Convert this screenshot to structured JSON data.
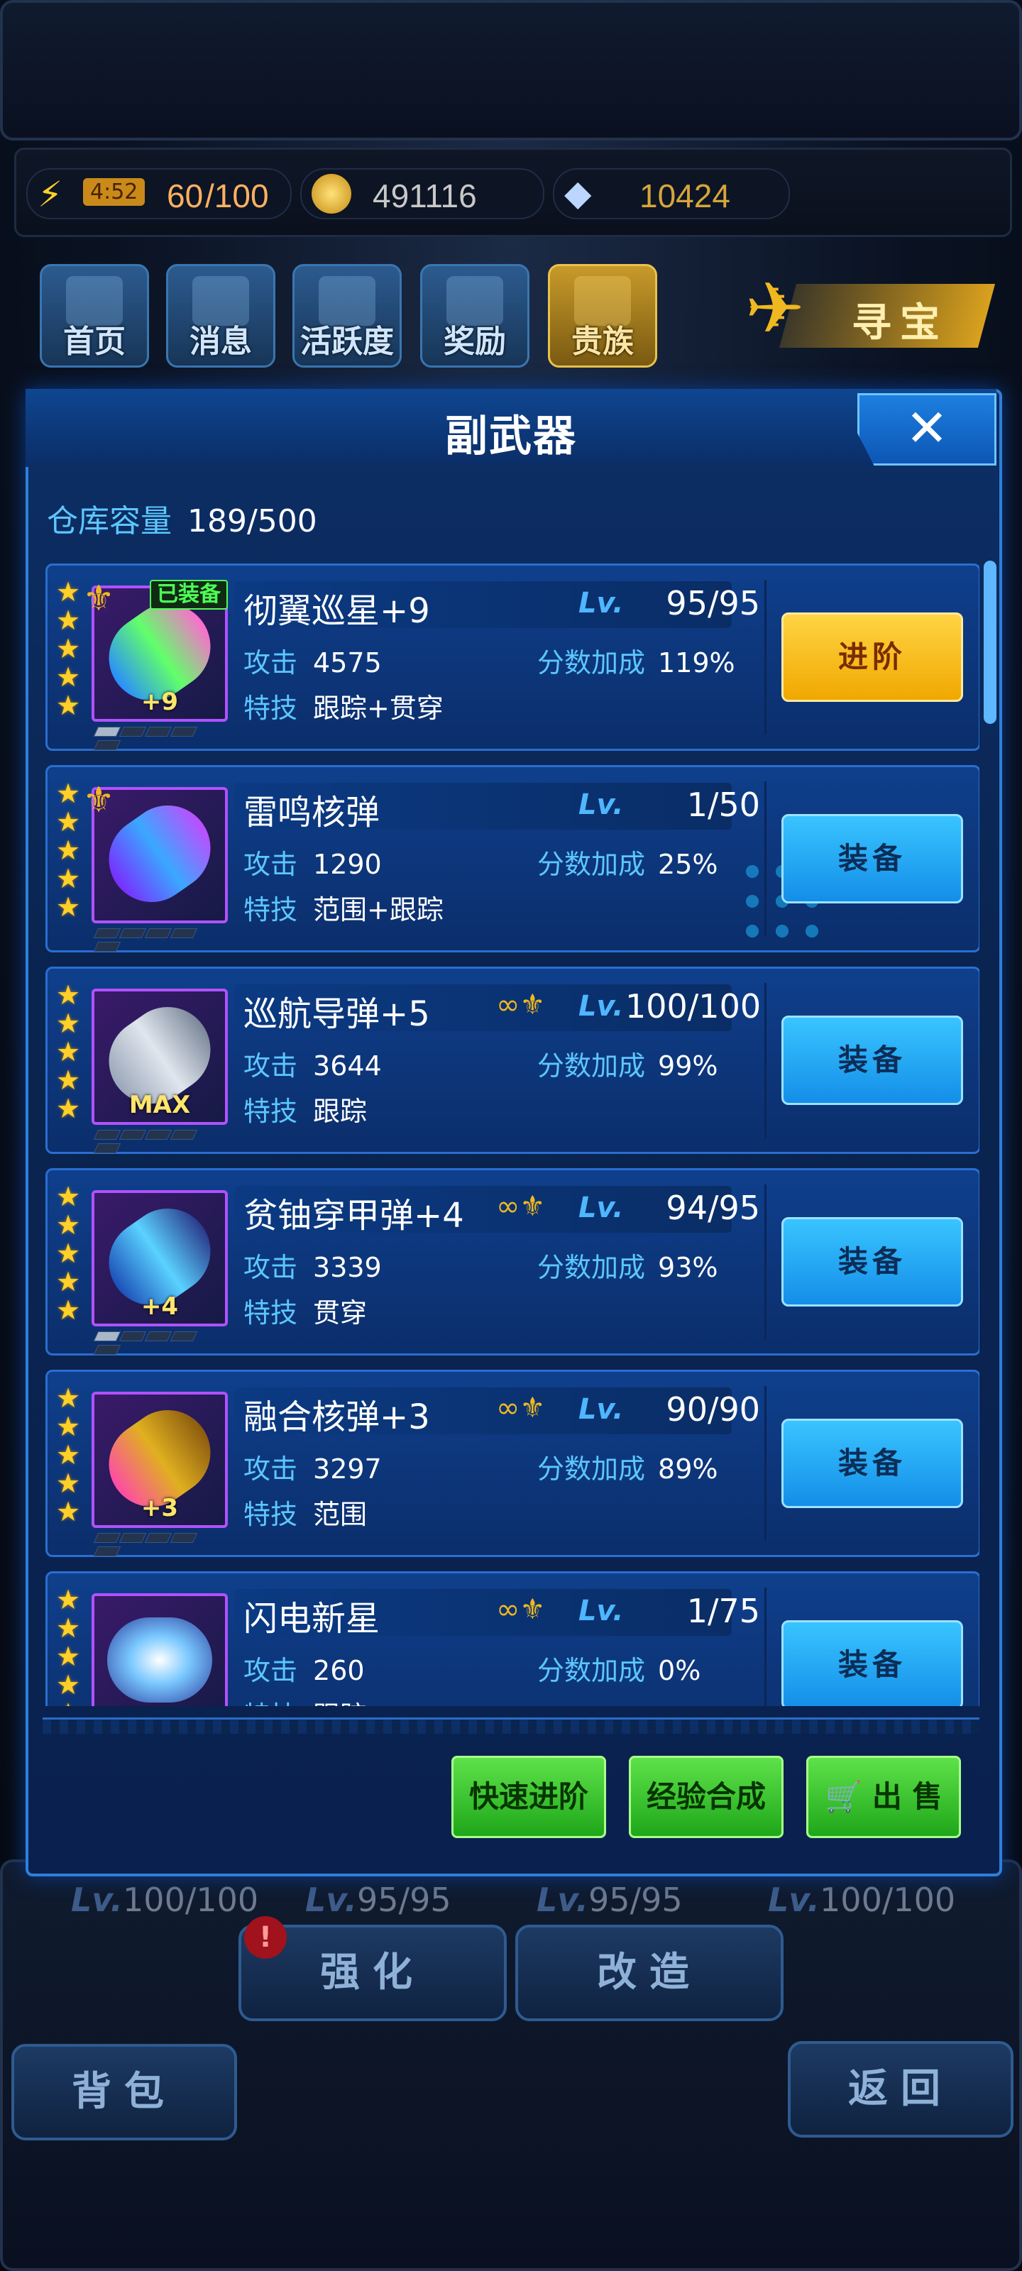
{
  "resources": {
    "timer": "4:52",
    "energy_current": "60",
    "energy_max": "/100",
    "gold": "491116",
    "gems": "10424"
  },
  "nav": [
    {
      "label": "首页"
    },
    {
      "label": "消息"
    },
    {
      "label": "活跃度"
    },
    {
      "label": "奖励"
    },
    {
      "label": "贵族"
    }
  ],
  "treasure_label": "寻宝",
  "dialog": {
    "title": "副武器",
    "capacity_label": "仓库容量",
    "capacity_value": "189/500"
  },
  "weapons": [
    {
      "name": "彻翼巡星+9",
      "level": "95/95",
      "attack": "4575",
      "bonus": "119%",
      "skill": "跟踪+贯穿",
      "thumb_text": "+9",
      "equipped": "已装备",
      "button": "进阶"
    },
    {
      "name": "雷鸣核弹",
      "level": "1/50",
      "attack": "1290",
      "bonus": "25%",
      "skill": "范围+跟踪",
      "thumb_text": "",
      "button": "装备"
    },
    {
      "name": "巡航导弹+5",
      "level": "100/100",
      "attack": "3644",
      "bonus": "99%",
      "skill": "跟踪",
      "thumb_text": "MAX",
      "button": "装备"
    },
    {
      "name": "贫铀穿甲弹+4",
      "level": "94/95",
      "attack": "3339",
      "bonus": "93%",
      "skill": "贯穿",
      "thumb_text": "+4",
      "button": "装备"
    },
    {
      "name": "融合核弹+3",
      "level": "90/90",
      "attack": "3297",
      "bonus": "89%",
      "skill": "范围",
      "thumb_text": "+3",
      "button": "装备"
    },
    {
      "name": "闪电新星",
      "level": "1/75",
      "attack": "260",
      "bonus": "0%",
      "skill": "跟踪",
      "thumb_text": "",
      "button": "装备"
    }
  ],
  "labels": {
    "lv": "Lv.",
    "attack": "攻击",
    "bonus": "分数加成",
    "skill": "特技"
  },
  "actions": {
    "quick_advance": "快速进阶",
    "exp_merge": "经验合成",
    "sell": "出 售"
  },
  "behind": {
    "levels": [
      "100/100",
      "95/95",
      "95/95",
      "100/100"
    ],
    "strengthen": "强化",
    "modify": "改造",
    "bag": "背包",
    "back": "返回",
    "alert": "!"
  },
  "colors": {
    "panel": "#0a2450",
    "accent_blue": "#5cc7ff",
    "star": "#ffd02a",
    "equipped_green": "#4dff55",
    "advance_orange": "#f0a800",
    "action_green": "#1fa71a"
  }
}
